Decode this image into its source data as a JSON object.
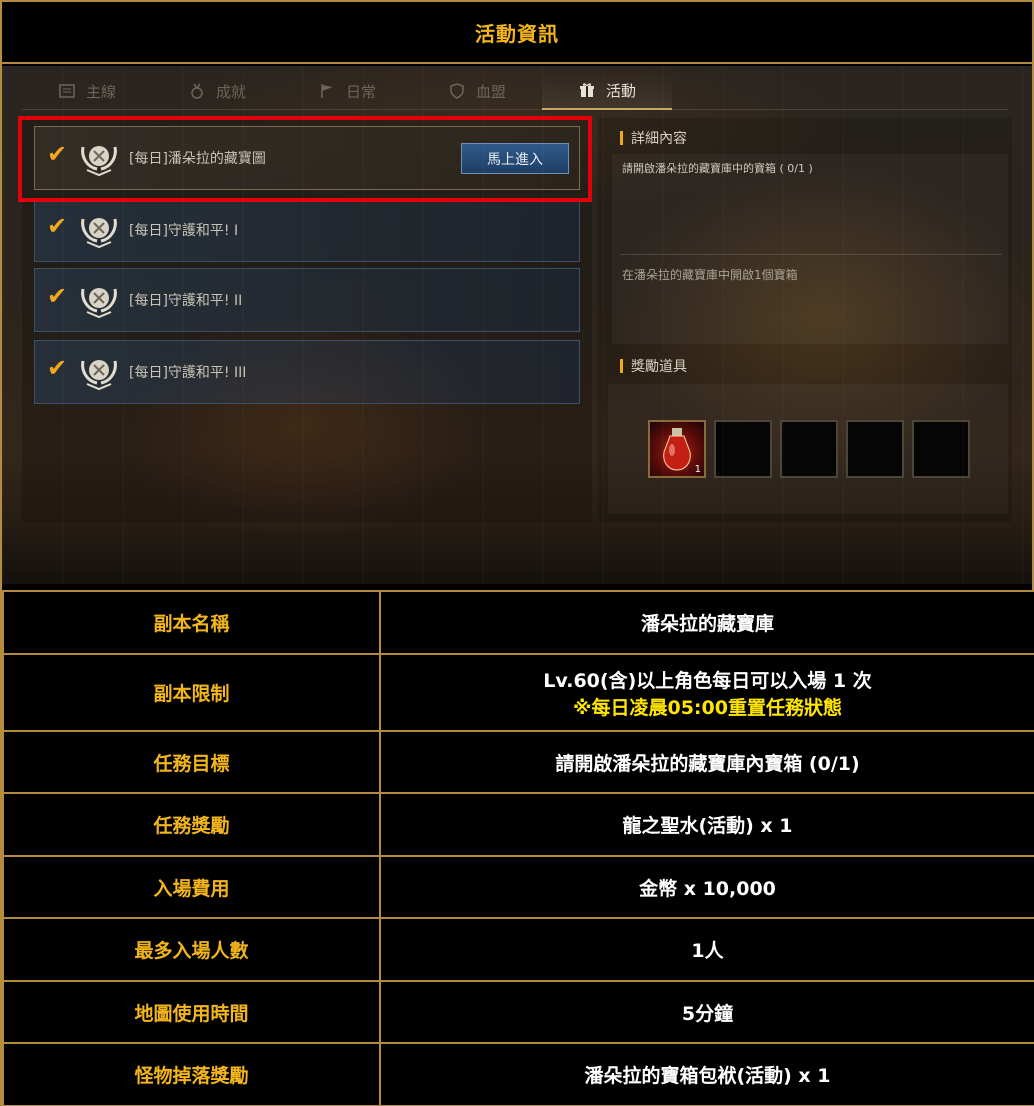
{
  "header": {
    "title": "活動資訊"
  },
  "tabs": [
    {
      "label": "主線",
      "icon": "book-icon",
      "active": false
    },
    {
      "label": "成就",
      "icon": "medal-icon",
      "active": false
    },
    {
      "label": "日常",
      "icon": "flag-icon",
      "active": false
    },
    {
      "label": "血盟",
      "icon": "shield-icon",
      "active": false
    },
    {
      "label": "活動",
      "icon": "gift-icon",
      "active": true
    }
  ],
  "quests": [
    {
      "name": "[每日]潘朵拉的藏寶圖",
      "checked": true,
      "selected": true,
      "button": "馬上進入"
    },
    {
      "name": "[每日]守護和平! I",
      "checked": true,
      "selected": false
    },
    {
      "name": "[每日]守護和平! II",
      "checked": true,
      "selected": false
    },
    {
      "name": "[每日]守護和平! III",
      "checked": true,
      "selected": false
    }
  ],
  "detail": {
    "section_title": "詳細內容",
    "objective": "請開啟潘朵拉的藏寶庫中的寶箱 ( 0/1 )",
    "description": "在潘朵拉的藏寶庫中開啟1個寶箱",
    "reward_title": "獎勵道具",
    "reward_slots": [
      {
        "item": "potion-icon",
        "qty": "1"
      },
      {
        "item": "empty"
      },
      {
        "item": "empty"
      },
      {
        "item": "empty"
      },
      {
        "item": "empty"
      }
    ]
  },
  "table": {
    "rows": [
      {
        "label": "副本名稱",
        "value": "潘朵拉的藏寶庫"
      },
      {
        "label": "副本限制",
        "value": "Lv.60(含)以上角色每日可以入場 1 次",
        "note": "※每日凌晨05:00重置任務狀態"
      },
      {
        "label": "任務目標",
        "value": "請開啟潘朵拉的藏寶庫內寶箱 (0/1)"
      },
      {
        "label": "任務獎勵",
        "value": "龍之聖水(活動) x 1"
      },
      {
        "label": "入場費用",
        "value": "金幣 x 10,000"
      },
      {
        "label": "最多入場人數",
        "value": "1人"
      },
      {
        "label": "地圖使用時間",
        "value": "5分鐘"
      },
      {
        "label": "怪物掉落獎勵",
        "value": "潘朵拉的寶箱包袱(活動) x 1"
      }
    ]
  },
  "colors": {
    "accent_gold": "#f2b51c",
    "border_gold": "#b58b3e",
    "highlight_red": "#e4000b",
    "note_yellow": "#ffe600"
  }
}
